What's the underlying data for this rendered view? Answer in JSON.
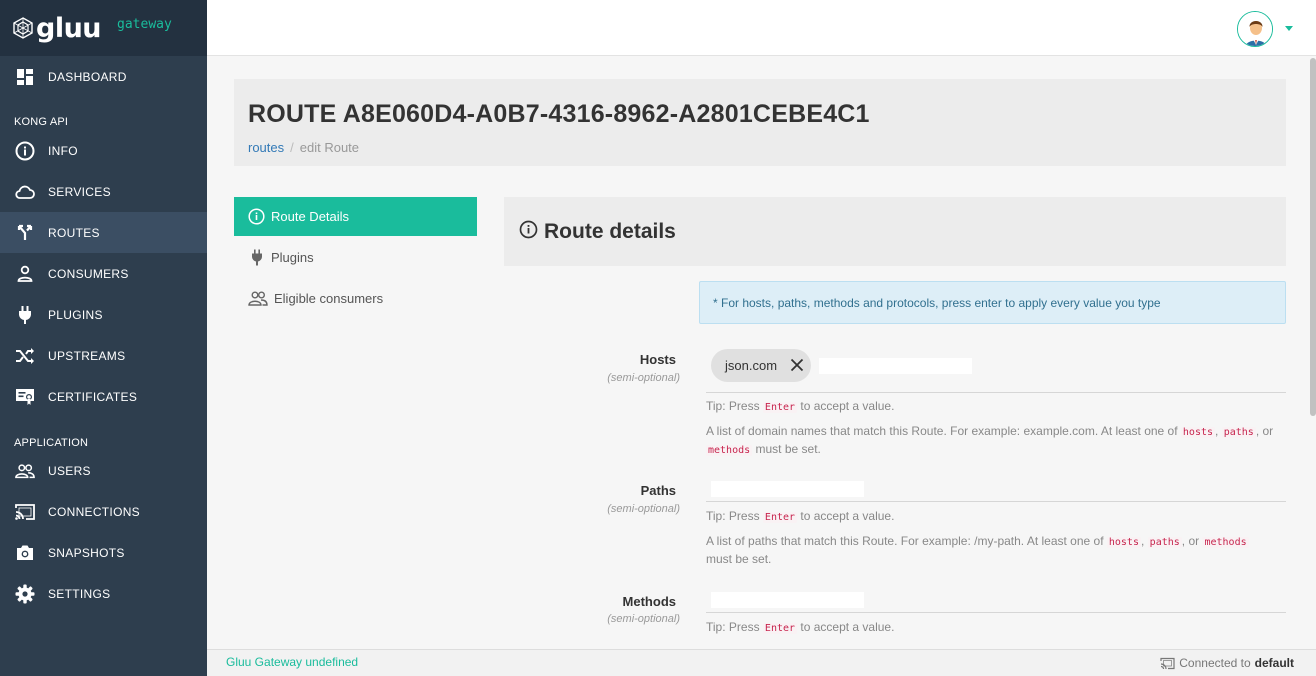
{
  "brand": {
    "name": "gluu",
    "subtitle": "gateway"
  },
  "sidebar": {
    "dashboard": "DASHBOARD",
    "section_kong": "KONG API",
    "info": "INFO",
    "services": "SERVICES",
    "routes": "ROUTES",
    "consumers": "CONSUMERS",
    "plugins": "PLUGINS",
    "upstreams": "UPSTREAMS",
    "certificates": "CERTIFICATES",
    "section_app": "APPLICATION",
    "users": "USERS",
    "connections": "CONNECTIONS",
    "snapshots": "SNAPSHOTS",
    "settings": "SETTINGS",
    "active": "ROUTES"
  },
  "header": {
    "title": "ROUTE A8E060D4-A0B7-4316-8962-A2801CEBE4C1",
    "breadcrumb_link": "routes",
    "breadcrumb_sep": "/",
    "breadcrumb_current": "edit Route"
  },
  "tabs": {
    "route_details": "Route Details",
    "plugins": "Plugins",
    "eligible_consumers": "Eligible consumers"
  },
  "details": {
    "title": "Route details",
    "notice": "* For hosts, paths, methods and protocols, press enter to apply every value you type"
  },
  "fields": {
    "hosts": {
      "label": "Hosts",
      "sub": "(semi-optional)",
      "tag": "json.com",
      "tip_pre": "Tip: Press",
      "tip_key": "Enter",
      "tip_post": "to accept a value.",
      "desc_pre": "A list of domain names that match this Route. For example: example.com. At least one of",
      "code1": "hosts",
      "code2": "paths",
      "code3": "methods",
      "sep1": ",",
      "sep2": ", or",
      "desc_post": "must be set."
    },
    "paths": {
      "label": "Paths",
      "sub": "(semi-optional)",
      "tip_pre": "Tip: Press",
      "tip_key": "Enter",
      "tip_post": "to accept a value.",
      "desc_pre": "A list of paths that match this Route. For example: /my-path. At least one of",
      "code1": "hosts",
      "code2": "paths",
      "code3": "methods",
      "sep1": ",",
      "sep2": ", or",
      "desc_post": "must be set."
    },
    "methods": {
      "label": "Methods",
      "sub": "(semi-optional)",
      "tip_pre": "Tip: Press",
      "tip_key": "Enter",
      "tip_post": "to accept a value."
    }
  },
  "footer": {
    "left": "Gluu Gateway undefined",
    "right_pre": "Connected to",
    "right_bold": "default"
  },
  "colors": {
    "accent": "#1abc9c",
    "sidebar": "#2e3e4e",
    "sidebar_brand": "#233140"
  },
  "icons": {
    "dashboard": "dashboard-icon",
    "info": "info-icon",
    "services": "cloud-icon",
    "routes": "fork-icon",
    "consumers": "person-icon",
    "plugins": "plug-icon",
    "upstreams": "shuffle-icon",
    "certificates": "certificate-icon",
    "users": "people-icon",
    "connections": "cast-icon",
    "snapshots": "camera-icon",
    "settings": "gear-icon"
  }
}
